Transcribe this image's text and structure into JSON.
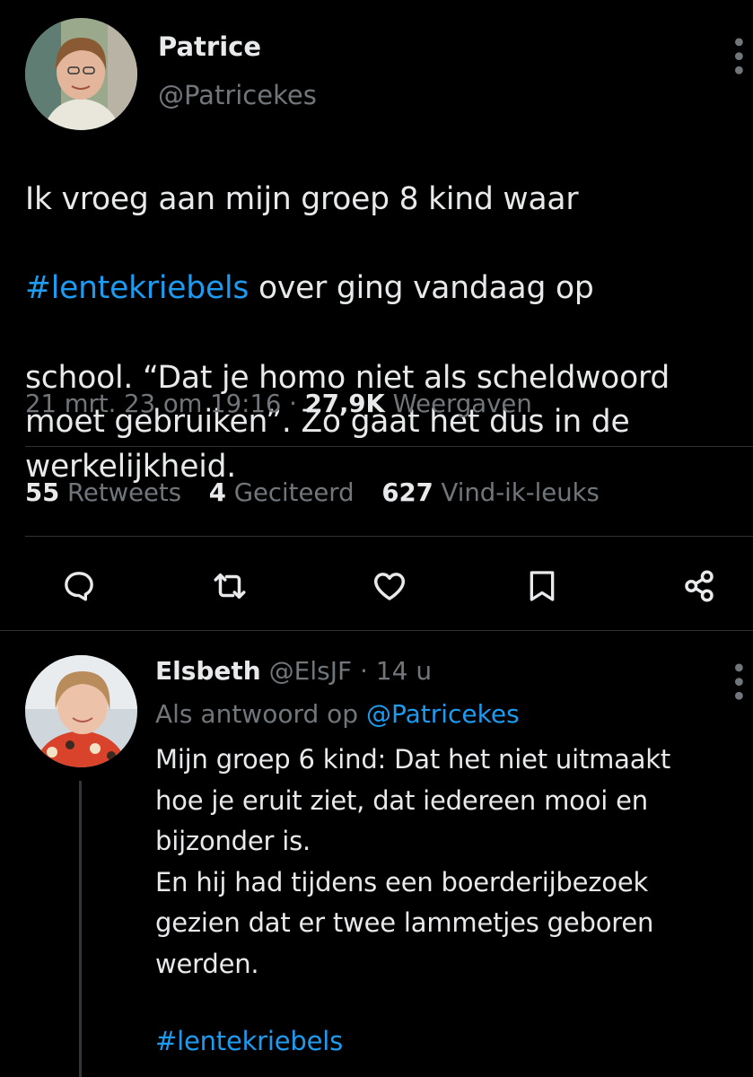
{
  "tweet": {
    "author_name": "Patrice",
    "author_handle": "@Patricekes",
    "text_line1": "Ik vroeg aan mijn groep 8 kind waar",
    "hashtag": "#lentekriebels",
    "text_after_hashtag": " over ging vandaag op",
    "text_rest": "school. “Dat je homo niet als scheldwoord\nmoet gebruiken”. Zo gaat het dus in de\nwerkelijkheid.",
    "timestamp": "21 mrt. 23 om 19:16",
    "separator": " · ",
    "views_count": "27,9K",
    "views_label": " Weergaven",
    "stats": {
      "retweets_count": "55",
      "retweets_label": "Retweets",
      "quotes_count": "4",
      "quotes_label": "Geciteerd",
      "likes_count": "627",
      "likes_label": "Vind-ik-leuks"
    },
    "actions": [
      "reply-icon",
      "retweet-icon",
      "like-icon",
      "bookmark-icon",
      "share-icon"
    ]
  },
  "reply": {
    "author_name": "Elsbeth",
    "author_handle": "@ElsJF",
    "time": "· 14 u",
    "replying_prefix": "Als antwoord op ",
    "replying_handle": "@Patricekes",
    "text": "Mijn groep 6 kind: Dat het niet uitmaakt\nhoe je eruit ziet, dat iedereen mooi en\nbijzonder is.\nEn hij had tijdens een boerderijbezoek\ngezien dat er twee lammetjes geboren\nwerden.",
    "hashtag": "#lentekriebels"
  },
  "colors": {
    "background": "#000000",
    "text": "#e7e9ea",
    "muted": "#71767b",
    "link": "#1d9bf0",
    "divider": "#2f3336"
  }
}
